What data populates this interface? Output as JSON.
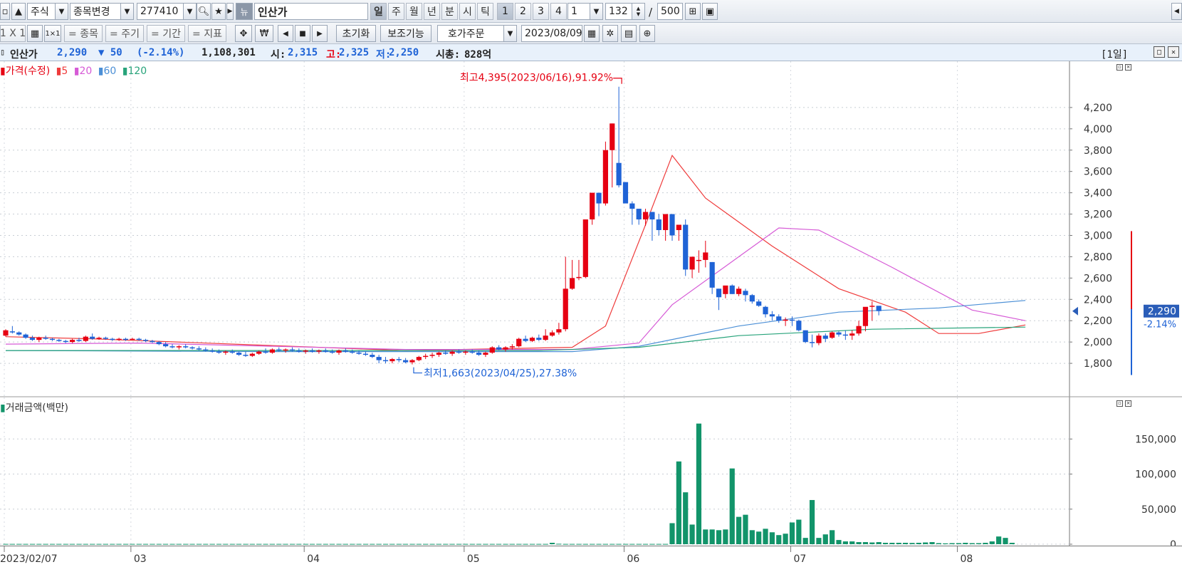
{
  "toolbar1": {
    "market": "주식",
    "change_stock_label": "종목변경",
    "stock_code": "277410",
    "news_icon_label": "뉴",
    "stock_name": "인산가",
    "periods": [
      "일",
      "주",
      "월",
      "년",
      "분",
      "시",
      "틱"
    ],
    "nums": [
      "1",
      "2",
      "3",
      "4"
    ],
    "interval_value": "1",
    "count_value": "132",
    "separator": "/",
    "max_count": "500"
  },
  "toolbar2": {
    "layout_label": "1 X 1",
    "buttons": [
      "= 종목",
      "= 주기",
      "= 기간",
      "= 지표"
    ],
    "reset_label": "초기화",
    "aux_label": "보조기능",
    "order_label": "호가주문",
    "date_value": "2023/08/09"
  },
  "info": {
    "name": "인산가",
    "price": "2,290",
    "change": "▼ 50",
    "change_pct": "(-2.14%)",
    "volume": "1,108,301",
    "open_label": "시:",
    "open": "2,315",
    "high_label": "고:",
    "high": "2,325",
    "low_label": "저:",
    "low": "2,250",
    "mcap_label": "시총:",
    "mcap": "828억",
    "period_tag": "[1일]"
  },
  "legend": {
    "price": "가격(수정)",
    "ma": [
      "5",
      "20",
      "60",
      "120"
    ],
    "volume": "거래금액(백만)"
  },
  "annotations": {
    "high": "최고4,395(2023/06/16),91.92%",
    "low": "최저1,663(2023/04/25),27.38%",
    "current_price": "2,290",
    "current_pct": "-2.14%"
  },
  "colors": {
    "up": "#e60012",
    "down": "#1f63d6",
    "ma5": "#ef3b3b",
    "ma20": "#d65ad6",
    "ma60": "#4b8fd6",
    "ma120": "#27a37a",
    "volume": "#12946a"
  },
  "chart_data": [
    {
      "type": "candlestick",
      "title": "가격(수정)",
      "series_name": "인산가",
      "y_ticks": [
        1800,
        2000,
        2200,
        2400,
        2600,
        2800,
        3000,
        3200,
        3400,
        3600,
        3800,
        4000,
        4200
      ],
      "ylim": [
        1560,
        4500
      ],
      "x_labels": [
        "2023/02/07",
        "03",
        "04",
        "05",
        "06",
        "07",
        "08"
      ],
      "ohlc": [
        [
          2060,
          2120,
          2050,
          2110
        ],
        [
          2100,
          2150,
          2080,
          2090
        ],
        [
          2090,
          2100,
          2060,
          2070
        ],
        [
          2070,
          2080,
          2030,
          2040
        ],
        [
          2040,
          2060,
          2010,
          2020
        ],
        [
          2020,
          2050,
          2000,
          2040
        ],
        [
          2040,
          2060,
          2020,
          2030
        ],
        [
          2030,
          2040,
          2010,
          2020
        ],
        [
          2020,
          2030,
          2000,
          2010
        ],
        [
          2010,
          2020,
          1990,
          2000
        ],
        [
          2000,
          2030,
          1990,
          2020
        ],
        [
          2020,
          2040,
          2000,
          2010
        ],
        [
          2010,
          2060,
          2000,
          2050
        ],
        [
          2050,
          2080,
          2020,
          2030
        ],
        [
          2030,
          2050,
          2020,
          2040
        ],
        [
          2040,
          2050,
          2020,
          2030
        ],
        [
          2030,
          2040,
          2010,
          2020
        ],
        [
          2020,
          2040,
          2010,
          2030
        ],
        [
          2030,
          2040,
          2010,
          2020
        ],
        [
          2020,
          2040,
          2020,
          2030
        ],
        [
          2030,
          2040,
          2010,
          2020
        ],
        [
          2020,
          2030,
          2000,
          2010
        ],
        [
          2010,
          2020,
          1990,
          2000
        ],
        [
          2000,
          2010,
          1970,
          1980
        ],
        [
          1980,
          2000,
          1950,
          1960
        ],
        [
          1960,
          1980,
          1940,
          1950
        ],
        [
          1950,
          1970,
          1930,
          1960
        ],
        [
          1960,
          1980,
          1940,
          1950
        ],
        [
          1950,
          1960,
          1930,
          1940
        ],
        [
          1940,
          1960,
          1920,
          1930
        ],
        [
          1930,
          1950,
          1910,
          1920
        ],
        [
          1920,
          1940,
          1900,
          1910
        ],
        [
          1910,
          1930,
          1890,
          1900
        ],
        [
          1900,
          1920,
          1880,
          1910
        ],
        [
          1910,
          1930,
          1890,
          1900
        ],
        [
          1900,
          1910,
          1870,
          1880
        ],
        [
          1880,
          1910,
          1860,
          1870
        ],
        [
          1870,
          1900,
          1860,
          1890
        ],
        [
          1890,
          1920,
          1880,
          1910
        ],
        [
          1910,
          1940,
          1890,
          1900
        ],
        [
          1900,
          1940,
          1890,
          1930
        ],
        [
          1930,
          1950,
          1910,
          1920
        ],
        [
          1920,
          1940,
          1900,
          1930
        ],
        [
          1930,
          1950,
          1910,
          1920
        ],
        [
          1920,
          1940,
          1900,
          1910
        ],
        [
          1910,
          1930,
          1890,
          1920
        ],
        [
          1920,
          1940,
          1900,
          1910
        ],
        [
          1910,
          1930,
          1890,
          1920
        ],
        [
          1920,
          1940,
          1900,
          1910
        ],
        [
          1910,
          1930,
          1890,
          1900
        ],
        [
          1900,
          1930,
          1880,
          1920
        ],
        [
          1920,
          1940,
          1900,
          1910
        ],
        [
          1910,
          1930,
          1890,
          1900
        ],
        [
          1900,
          1920,
          1880,
          1890
        ],
        [
          1890,
          1910,
          1870,
          1880
        ],
        [
          1880,
          1900,
          1850,
          1860
        ],
        [
          1860,
          1880,
          1800,
          1830
        ],
        [
          1830,
          1860,
          1800,
          1820
        ],
        [
          1820,
          1850,
          1800,
          1840
        ],
        [
          1840,
          1860,
          1810,
          1830
        ],
        [
          1830,
          1850,
          1800,
          1810
        ],
        [
          1810,
          1840,
          1790,
          1830
        ],
        [
          1830,
          1870,
          1820,
          1860
        ],
        [
          1860,
          1890,
          1840,
          1870
        ],
        [
          1870,
          1900,
          1850,
          1880
        ],
        [
          1880,
          1910,
          1860,
          1900
        ],
        [
          1900,
          1920,
          1880,
          1890
        ],
        [
          1890,
          1920,
          1870,
          1910
        ],
        [
          1910,
          1930,
          1890,
          1900
        ],
        [
          1900,
          1920,
          1880,
          1910
        ],
        [
          1910,
          1930,
          1890,
          1900
        ],
        [
          1900,
          1920,
          1870,
          1880
        ],
        [
          1880,
          1910,
          1860,
          1900
        ],
        [
          1900,
          1960,
          1890,
          1950
        ],
        [
          1950,
          1970,
          1920,
          1930
        ],
        [
          1930,
          1960,
          1910,
          1950
        ],
        [
          1950,
          1980,
          1930,
          1960
        ],
        [
          1960,
          2040,
          1950,
          2030
        ],
        [
          2030,
          2060,
          2000,
          2010
        ],
        [
          2010,
          2050,
          2000,
          2040
        ],
        [
          2040,
          2070,
          2010,
          2020
        ],
        [
          2020,
          2120,
          2010,
          2060
        ],
        [
          2060,
          2110,
          2050,
          2090
        ],
        [
          2090,
          2180,
          2070,
          2120
        ],
        [
          2120,
          2800,
          2100,
          2500
        ],
        [
          2500,
          2770,
          2490,
          2600
        ],
        [
          2600,
          2770,
          2580,
          2610
        ],
        [
          2610,
          2900,
          2600,
          3150
        ],
        [
          3150,
          3400,
          3100,
          3400
        ],
        [
          3400,
          3380,
          3180,
          3300
        ],
        [
          3300,
          3880,
          3280,
          3800
        ],
        [
          3800,
          4050,
          3450,
          4050
        ],
        [
          3680,
          4395,
          3450,
          3470
        ],
        [
          3500,
          3500,
          3320,
          3300
        ],
        [
          3300,
          3320,
          3100,
          3250
        ],
        [
          3250,
          3250,
          3100,
          3150
        ],
        [
          3150,
          3250,
          3090,
          3220
        ],
        [
          3220,
          3220,
          2950,
          3150
        ],
        [
          3150,
          3200,
          3000,
          3050
        ],
        [
          3050,
          3200,
          2950,
          3200
        ],
        [
          3200,
          3150,
          2950,
          3000
        ],
        [
          3050,
          3050,
          2950,
          3100
        ],
        [
          3100,
          3150,
          2620,
          2680
        ],
        [
          2680,
          2800,
          2600,
          2800
        ],
        [
          2760,
          2860,
          2650,
          2770
        ],
        [
          2770,
          2950,
          2700,
          2840
        ],
        [
          2750,
          2750,
          2450,
          2510
        ],
        [
          2500,
          2500,
          2300,
          2420
        ],
        [
          2450,
          2520,
          2410,
          2530
        ],
        [
          2530,
          2540,
          2450,
          2450
        ],
        [
          2450,
          2520,
          2430,
          2500
        ],
        [
          2480,
          2500,
          2380,
          2440
        ],
        [
          2440,
          2450,
          2360,
          2380
        ],
        [
          2380,
          2400,
          2330,
          2340
        ],
        [
          2330,
          2340,
          2230,
          2260
        ],
        [
          2260,
          2290,
          2200,
          2240
        ],
        [
          2240,
          2260,
          2180,
          2200
        ],
        [
          2200,
          2230,
          2150,
          2210
        ],
        [
          2210,
          2240,
          2150,
          2200
        ],
        [
          2200,
          2210,
          2100,
          2110
        ],
        [
          2110,
          2110,
          1990,
          2000
        ],
        [
          2000,
          2070,
          1950,
          1990
        ],
        [
          1990,
          2080,
          1970,
          2060
        ],
        [
          2060,
          2080,
          2000,
          2030
        ],
        [
          2040,
          2100,
          2030,
          2090
        ],
        [
          2090,
          2100,
          2050,
          2070
        ],
        [
          2070,
          2110,
          2020,
          2060
        ],
        [
          2060,
          2110,
          2020,
          2080
        ],
        [
          2080,
          2200,
          2060,
          2150
        ],
        [
          2150,
          2260,
          2100,
          2330
        ],
        [
          2330,
          2380,
          2200,
          2340
        ],
        [
          2340,
          2325,
          2250,
          2290
        ]
      ],
      "ma": [
        {
          "name": "5",
          "points": [
            [
              0,
              2050
            ],
            [
              13,
              2030
            ],
            [
              60,
              1920
            ],
            [
              85,
              1950
            ],
            [
              90,
              2150
            ],
            [
              96,
              3100
            ],
            [
              100,
              3750
            ],
            [
              105,
              3350
            ],
            [
              115,
              2900
            ],
            [
              125,
              2500
            ],
            [
              135,
              2280
            ],
            [
              140,
              2080
            ],
            [
              146,
              2080
            ],
            [
              153,
              2160
            ]
          ]
        },
        {
          "name": "20",
          "points": [
            [
              0,
              1980
            ],
            [
              20,
              1990
            ],
            [
              60,
              1930
            ],
            [
              85,
              1930
            ],
            [
              95,
              1990
            ],
            [
              100,
              2350
            ],
            [
              110,
              2800
            ],
            [
              116,
              3070
            ],
            [
              122,
              3050
            ],
            [
              133,
              2700
            ],
            [
              145,
              2300
            ],
            [
              153,
              2200
            ]
          ]
        },
        {
          "name": "60",
          "points": [
            [
              0,
              1920
            ],
            [
              40,
              1910
            ],
            [
              85,
              1910
            ],
            [
              95,
              1960
            ],
            [
              110,
              2150
            ],
            [
              125,
              2280
            ],
            [
              140,
              2320
            ],
            [
              153,
              2390
            ]
          ]
        },
        {
          "name": "120",
          "points": [
            [
              0,
              1920
            ],
            [
              80,
              1920
            ],
            [
              95,
              1950
            ],
            [
              110,
              2060
            ],
            [
              130,
              2120
            ],
            [
              153,
              2140
            ]
          ]
        }
      ]
    },
    {
      "type": "bar",
      "title": "거래금액(백만)",
      "y_ticks": [
        0,
        50000,
        100000,
        150000
      ],
      "ylim": [
        0,
        195000
      ],
      "values": [
        400,
        400,
        400,
        400,
        400,
        400,
        400,
        400,
        400,
        400,
        400,
        400,
        400,
        400,
        400,
        400,
        400,
        400,
        400,
        400,
        400,
        400,
        400,
        400,
        400,
        400,
        400,
        400,
        400,
        400,
        400,
        400,
        400,
        400,
        400,
        400,
        400,
        400,
        400,
        400,
        400,
        400,
        400,
        400,
        400,
        400,
        400,
        400,
        400,
        400,
        400,
        400,
        400,
        400,
        400,
        400,
        400,
        400,
        400,
        400,
        400,
        400,
        400,
        400,
        400,
        400,
        400,
        400,
        400,
        400,
        400,
        400,
        400,
        400,
        400,
        400,
        400,
        400,
        400,
        400,
        400,
        400,
        2000,
        600,
        400,
        400,
        400,
        400,
        400,
        400,
        400,
        400,
        400,
        400,
        400,
        400,
        400,
        400,
        400,
        400,
        30000,
        118000,
        74000,
        28000,
        172000,
        21000,
        21000,
        20000,
        21000,
        108000,
        39000,
        42000,
        20000,
        18000,
        22000,
        17000,
        13000,
        15000,
        31000,
        35000,
        9000,
        63000,
        9000,
        14000,
        20000,
        6000,
        4000,
        4000,
        3000,
        3000,
        2500,
        3000,
        2000,
        2000,
        2000,
        2000,
        1800,
        2000,
        2500,
        3000,
        1500,
        1200,
        1500,
        1500,
        2000,
        1500,
        1500,
        2000,
        4000,
        11000,
        9000,
        2000
      ]
    }
  ]
}
